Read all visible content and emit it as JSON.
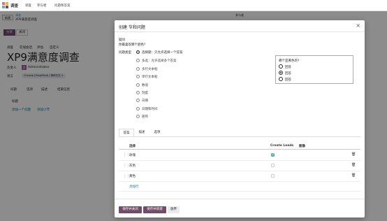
{
  "app": {
    "name": "调查",
    "menu": [
      "调查",
      "参与者",
      "问题和答案"
    ]
  },
  "background": {
    "new_button": "新建",
    "breadcrumb_parent": "调查",
    "breadcrumb_current": "XP9满意度调查",
    "share_button": "分享",
    "close_button": "关闭",
    "survey_tabs": [
      "调查",
      "在线会话",
      "评估",
      "自定义"
    ],
    "title": "XP9满意度调查",
    "responsible_label": "负责人",
    "avatar_letter": "A",
    "responsible": "Administrator",
    "language_label": "语言",
    "language_tag": "Chinese (Simplified) / 简体中文 ×",
    "tabs": [
      "问题",
      "选项",
      "描述",
      "结束信息"
    ],
    "section_header": "标题",
    "add_question": "添加一个问题",
    "add_section": "添加小节",
    "right_label": "参与者"
  },
  "modal": {
    "title": "创建 节和问题",
    "close_symbol": "×",
    "question_label": "疑问",
    "question_text": "你最喜欢哪个颜色?",
    "question_type_label": "问题类型",
    "question_types": [
      {
        "label": "选择题：只允许选择一个答案",
        "checked": true
      },
      {
        "label": "多选：允许选择多个答案",
        "checked": false
      },
      {
        "label": "多行文本框",
        "checked": false
      },
      {
        "label": "单行文本框",
        "checked": false
      },
      {
        "label": "数值",
        "checked": false
      },
      {
        "label": "刻度",
        "checked": false
      },
      {
        "label": "日期",
        "checked": false
      },
      {
        "label": "日期和时间",
        "checked": false
      },
      {
        "label": "矩阵",
        "checked": false
      }
    ],
    "preview": {
      "question": "哪个是黄色的?",
      "options": [
        {
          "label": "回答",
          "checked": false
        },
        {
          "label": "回答",
          "checked": true
        },
        {
          "label": "回答",
          "checked": false
        }
      ]
    },
    "tabs": [
      {
        "label": "答案",
        "active": true
      },
      {
        "label": "描述",
        "active": false
      },
      {
        "label": "选项",
        "active": false
      }
    ],
    "table": {
      "columns": [
        "选择",
        "Create Leads",
        "图像"
      ],
      "rows": [
        {
          "value": "玫瑰",
          "create_leads": true
        },
        {
          "value": "灰色",
          "create_leads": false
        },
        {
          "value": "黄色",
          "create_leads": false
        }
      ],
      "add_row": "添加行",
      "delete_icon": "trash-icon"
    },
    "footer": {
      "save_close": "保存并关闭",
      "save_new": "保存并新建",
      "discard": "放弃"
    }
  },
  "colors": {
    "brand": "#714b67",
    "link": "#017e84",
    "checkbox": "#5fb2b8"
  }
}
